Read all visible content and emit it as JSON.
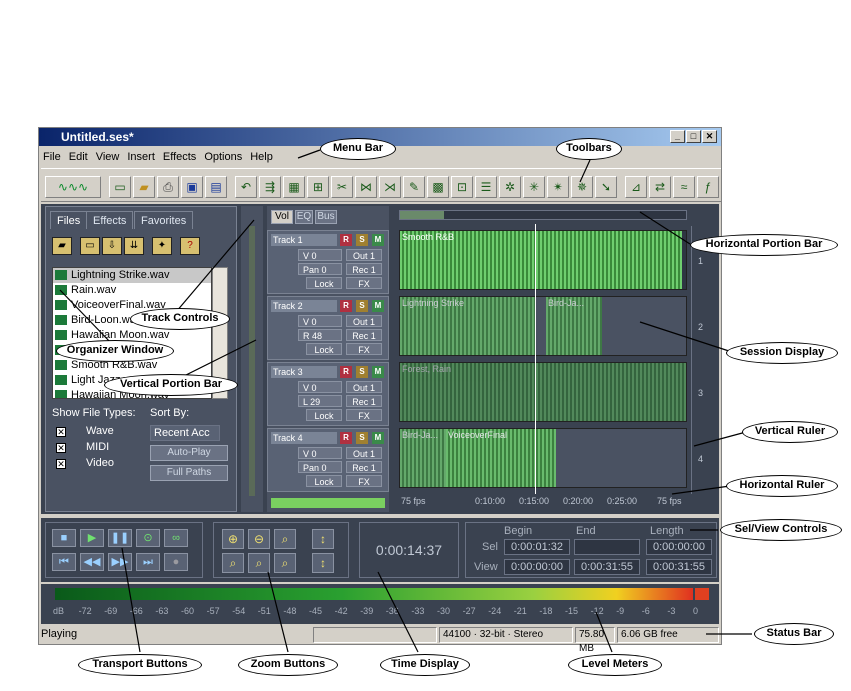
{
  "window": {
    "title": "Untitled.ses*"
  },
  "menu": [
    "File",
    "Edit",
    "View",
    "Insert",
    "Effects",
    "Options",
    "Help"
  ],
  "organizer": {
    "tabs": [
      "Files",
      "Effects",
      "Favorites"
    ],
    "files": [
      "Lightning Strike.wav",
      "Rain.wav",
      "VoiceoverFinal.wav",
      "Bird-Loon.wav",
      "Hawaiian Moon.wav",
      "Forest, Rain.wav",
      "Smooth R&B.wav",
      "Light Jazz.wav",
      "Hawaiian Moon.wav *"
    ],
    "show_file_types_label": "Show File Types:",
    "sort_by_label": "Sort By:",
    "types": [
      "Wave",
      "MIDI",
      "Video"
    ],
    "sort_value": "Recent Acc",
    "auto_play": "Auto-Play",
    "full_paths": "Full Paths"
  },
  "track_tabs": [
    "Vol",
    "EQ",
    "Bus"
  ],
  "tracks": [
    {
      "name": "Track 1",
      "vol": "V 0",
      "pan": "Pan 0",
      "out": "Out 1",
      "rec": "Rec 1",
      "lock": "Lock",
      "fx": "FX"
    },
    {
      "name": "Track 2",
      "vol": "V 0",
      "pan": "R 48",
      "out": "Out 1",
      "rec": "Rec 1",
      "lock": "Lock",
      "fx": "FX"
    },
    {
      "name": "Track 3",
      "vol": "V 0",
      "pan": "L 29",
      "out": "Out 1",
      "rec": "Rec 1",
      "lock": "Lock",
      "fx": "FX"
    },
    {
      "name": "Track 4",
      "vol": "V 0",
      "pan": "Pan 0",
      "out": "Out 1",
      "rec": "Rec 1",
      "lock": "Lock",
      "fx": "FX"
    }
  ],
  "rsm": [
    "R",
    "S",
    "M"
  ],
  "clips": [
    "Smooth R&B",
    "Lightning Strike",
    "Bird-Ja...",
    "Forest, Rain",
    "Bird-Ja...",
    "VoiceoverFinal"
  ],
  "ruler": {
    "labels": [
      "75 fps",
      "0:10:00",
      "0:15:00",
      "0:20:00",
      "0:25:00",
      "75 fps"
    ],
    "vertical": [
      "1",
      "2",
      "3",
      "4"
    ]
  },
  "time_display": "0:00:14:37",
  "selview": {
    "headers": [
      "Begin",
      "End",
      "Length"
    ],
    "sel_label": "Sel",
    "view_label": "View",
    "sel": [
      "0:00:01:32",
      "",
      "0:00:00:00"
    ],
    "view": [
      "0:00:00:00",
      "0:00:31:55",
      "0:00:31:55"
    ]
  },
  "meter_scale": [
    "dB",
    "-72",
    "-69",
    "-66",
    "-63",
    "-60",
    "-57",
    "-54",
    "-51",
    "-48",
    "-45",
    "-42",
    "-39",
    "-36",
    "-33",
    "-30",
    "-27",
    "-24",
    "-21",
    "-18",
    "-15",
    "-12",
    "-9",
    "-6",
    "-3",
    "0"
  ],
  "status": {
    "state": "Playing",
    "format": "44100 · 32-bit · Stereo",
    "size": "75.80 MB",
    "free": "6.06 GB free"
  },
  "callouts": {
    "menu_bar": "Menu Bar",
    "toolbars": "Toolbars",
    "horizontal_portion_bar": "Horizontal Portion Bar",
    "track_controls": "Track Controls",
    "organizer_window": "Organizer Window",
    "vertical_portion_bar": "Vertical Portion Bar",
    "session_display": "Session Display",
    "vertical_ruler": "Vertical Ruler",
    "horizontal_ruler": "Horizontal Ruler",
    "selview_controls": "Sel/View Controls",
    "status_bar": "Status Bar",
    "transport_buttons": "Transport Buttons",
    "zoom_buttons": "Zoom Buttons",
    "time_display": "Time Display",
    "level_meters": "Level Meters"
  }
}
